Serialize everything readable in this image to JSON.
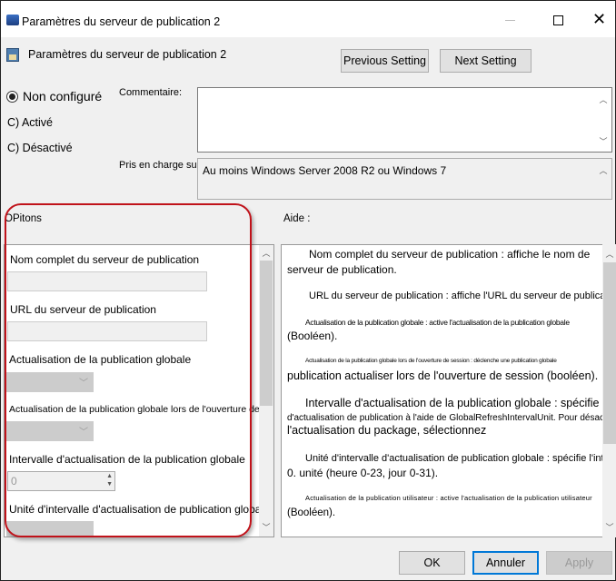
{
  "window": {
    "title": "Paramètres du serveur de publication 2"
  },
  "header": {
    "title": "Paramètres du serveur de publication 2",
    "previous_label": "Previous Setting",
    "next_label": "Next Setting"
  },
  "state": {
    "options": [
      {
        "label": "Non configuré",
        "selected": true
      },
      {
        "label": "C) Activé",
        "selected": false
      },
      {
        "label": "C) Désactivé",
        "selected": false
      }
    ]
  },
  "comment": {
    "label": "Commentaire:",
    "value": ""
  },
  "supported": {
    "label": "Pris en charge sur :",
    "value": "Au moins Windows Server 2008 R2 ou Windows 7"
  },
  "options_panel": {
    "title": "OPitons",
    "fields": {
      "name_label": "Nom complet du serveur de publication",
      "name_value": "",
      "url_label": "URL du serveur de publication",
      "url_value": "",
      "global_label": "Actualisation de la publication globale",
      "logon_label": "Actualisation de la publication globale lors de l'ouverture de session",
      "interval_label": "Intervalle d'actualisation de la publication globale",
      "interval_value": "0",
      "unit_label": "Unité d'intervalle d'actualisation de publication globale"
    }
  },
  "help_panel": {
    "title": "Aide :",
    "paragraphs": [
      "Nom complet du serveur de publication : affiche le nom de serveur de publication.",
      "URL du serveur de publication : affiche l'URL du serveur de publication.",
      "Actualisation de la publication globale : active l'actualisation de la publication globale",
      "(Booléen).",
      "Actualisation de la publication globale lors de l'ouverture de session : déclenche une publication globale",
      "publication actualiser lors de l'ouverture de session (booléen).",
      "Intervalle d'actualisation de la publication globale : spécifie l'intervalle",
      "d'actualisation de publication à l'aide de GlobalRefreshIntervalUnit. Pour désactiver",
      "l'actualisation du package, sélectionnez",
      "Unité d'intervalle d'actualisation de publication globale : spécifie l'intervalle",
      "0. unité (heure 0-23, jour 0-31).",
      "Actualisation de la publication utilisateur : active l'actualisation de la publication utilisateur",
      "(Booléen)."
    ]
  },
  "footer": {
    "ok_label": "OK",
    "cancel_label": "Annuler",
    "apply_label": "Apply"
  },
  "colors": {
    "highlight_annotation": "#c0121a",
    "focus_border": "#0078d7"
  }
}
